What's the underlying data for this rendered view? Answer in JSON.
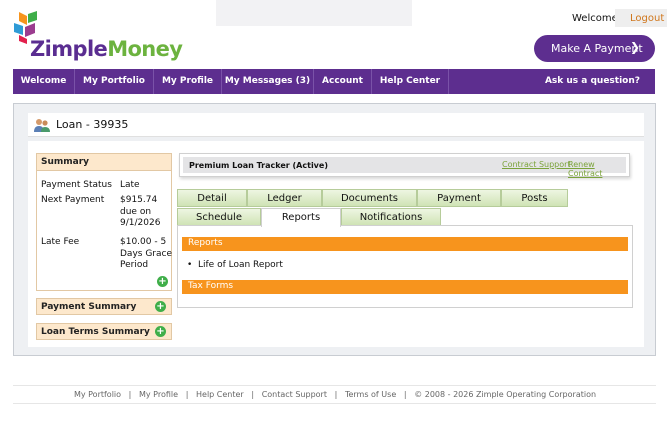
{
  "brand": {
    "name_part1": "Zimple",
    "name_part2": "Money",
    "color_purple": "#5d2e8f",
    "color_green": "#6cb33f"
  },
  "header": {
    "welcome": "Welcome",
    "logout": "Logout",
    "make_payment": "Make A Payment",
    "make_payment_icon": "chevron-right-icon"
  },
  "nav": {
    "items": [
      "Welcome",
      "My Portfolio",
      "My Profile",
      "My Messages (3)",
      "Account",
      "Help Center"
    ],
    "ask": "Ask us a question?"
  },
  "loan": {
    "title": "Loan - 39935",
    "icon": "people-icon"
  },
  "summary": {
    "heading": "Summary",
    "rows": [
      {
        "label": "Payment Status",
        "value": "Late"
      },
      {
        "label": "Next Payment",
        "value": "$915.74 due on 9/1/2026"
      },
      {
        "label": "Late Fee",
        "value": "$10.00 - 5 Days Grace Period"
      }
    ],
    "payment_summary": "Payment Summary",
    "loan_terms_summary": "Loan Terms Summary"
  },
  "tracker": {
    "title": "Premium Loan Tracker (Active)",
    "contract_support": "Contract Support",
    "renew_contract": "Renew Contract"
  },
  "tabs": {
    "row1": [
      "Detail",
      "Ledger",
      "Documents",
      "Payment",
      "Posts"
    ],
    "row2": [
      "Schedule",
      "Reports",
      "Notifications"
    ],
    "active": "Reports"
  },
  "reports_panel": {
    "reports_heading": "Reports",
    "items": [
      "Life of Loan Report"
    ],
    "tax_forms_heading": "Tax Forms"
  },
  "footer": {
    "links": [
      "My Portfolio",
      "My Profile",
      "Help Center",
      "Contact Support",
      "Terms of Use"
    ],
    "copyright": "© 2008 - 2026 Zimple Operating Corporation"
  },
  "colors": {
    "accent_orange": "#f7941d",
    "tab_green": "#cfe3b5",
    "link_green": "#7ba33a",
    "logout_orange": "#d0761b"
  }
}
